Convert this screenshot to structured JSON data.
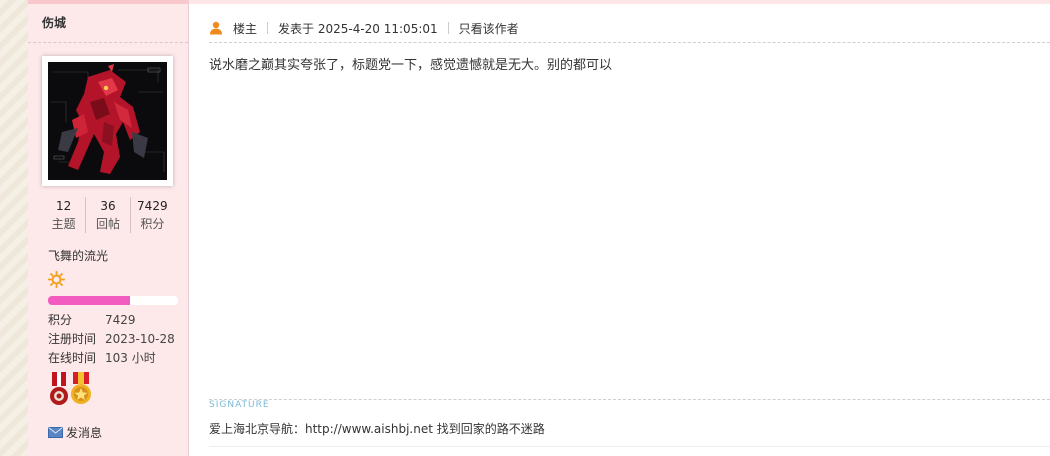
{
  "author": {
    "name": "伤城",
    "avatar_alt": "avatar",
    "stats": [
      {
        "num": "12",
        "label": "主题"
      },
      {
        "num": "36",
        "label": "回帖"
      },
      {
        "num": "7429",
        "label": "积分"
      }
    ],
    "group_name": "飞舞的流光",
    "level_progress_percent": 63,
    "info": [
      {
        "key": "积分",
        "value": "7429"
      },
      {
        "key": "注册时间",
        "value": "2023-10-28"
      },
      {
        "key": "在线时间",
        "value": "103 小时"
      }
    ],
    "pm_label": "发消息",
    "colors": {
      "progress": "#f25cc0",
      "sidebar_bg": "#fde8ea"
    }
  },
  "post": {
    "floor_label": "楼主",
    "posted_at": "发表于 2025-4-20 11:05:01",
    "only_author_label": "只看该作者",
    "body": "说水磨之巅其实夸张了，标题党一下，感觉遗憾就是无大。别的都可以",
    "signature_label": "SIGNATURE",
    "signature": "爱上海北京导航：http://www.aishbj.net 找到回家的路不迷路"
  }
}
